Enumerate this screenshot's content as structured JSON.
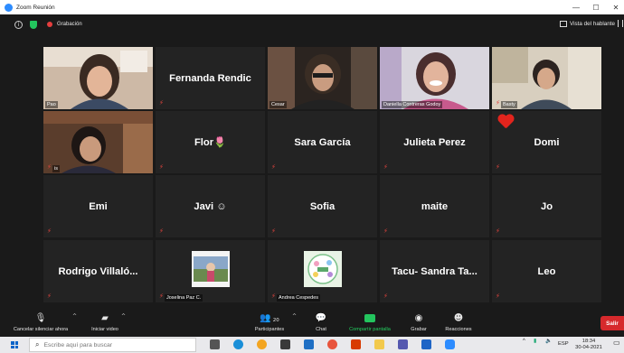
{
  "window": {
    "title": "Zoom Reunión",
    "minimize": "—",
    "maximize": "☐",
    "close": "✕"
  },
  "meeting": {
    "info_glyph": "i",
    "recording_label": "Grabación",
    "view_label": "Vista del hablante"
  },
  "participants": [
    {
      "name": "Pao",
      "display": "video",
      "muted": false
    },
    {
      "name": "Fernanda Rendic",
      "display": "name",
      "muted": true
    },
    {
      "name": "Cesar",
      "display": "video",
      "muted": false
    },
    {
      "name": "Daniella Contreras Godoy",
      "display": "video",
      "muted": false,
      "active_speaker": true
    },
    {
      "name": "Basty",
      "display": "video",
      "muted": true
    },
    {
      "name": "is",
      "display": "video",
      "muted": true
    },
    {
      "name": "Flor🌷",
      "display": "name",
      "muted": true
    },
    {
      "name": "Sara García",
      "display": "name",
      "muted": true
    },
    {
      "name": "Julieta Perez",
      "display": "name",
      "muted": true
    },
    {
      "name": "Domi",
      "display": "name",
      "muted": true,
      "reaction": "heart"
    },
    {
      "name": "Emi",
      "display": "name",
      "muted": true
    },
    {
      "name": "Javi ☺",
      "display": "name",
      "muted": true
    },
    {
      "name": "Sofia",
      "display": "name",
      "muted": true
    },
    {
      "name": "maite",
      "display": "name",
      "muted": true
    },
    {
      "name": "Jo",
      "display": "name",
      "muted": true
    },
    {
      "name": "Rodrigo  Villaló...",
      "display": "name",
      "muted": true
    },
    {
      "name": "Joselina Paz C.",
      "display": "image",
      "muted": true
    },
    {
      "name": "Andrea Cespedes",
      "display": "image",
      "muted": true
    },
    {
      "name": "Tacu- Sandra  Ta...",
      "display": "name",
      "muted": true
    },
    {
      "name": "Leo",
      "display": "name",
      "muted": true
    }
  ],
  "toolbar": {
    "unmute_label": "Cancelar silenciar ahora",
    "video_label": "Iniciar video",
    "participants_label": "Participantes",
    "participants_count": "20",
    "chat_label": "Chat",
    "share_label": "Compartir pantalla",
    "record_label": "Grabar",
    "reactions_label": "Reacciones",
    "leave_label": "Salir",
    "caret": "^"
  },
  "taskbar": {
    "search_placeholder": "Escribe aquí para buscar",
    "language": "ESP",
    "time": "18:34",
    "date": "30-04-2021"
  },
  "colors": {
    "active_border": "#c6d82c",
    "mute_red": "#e0443e",
    "share_green": "#23c55e",
    "leave_red": "#d6292c"
  }
}
